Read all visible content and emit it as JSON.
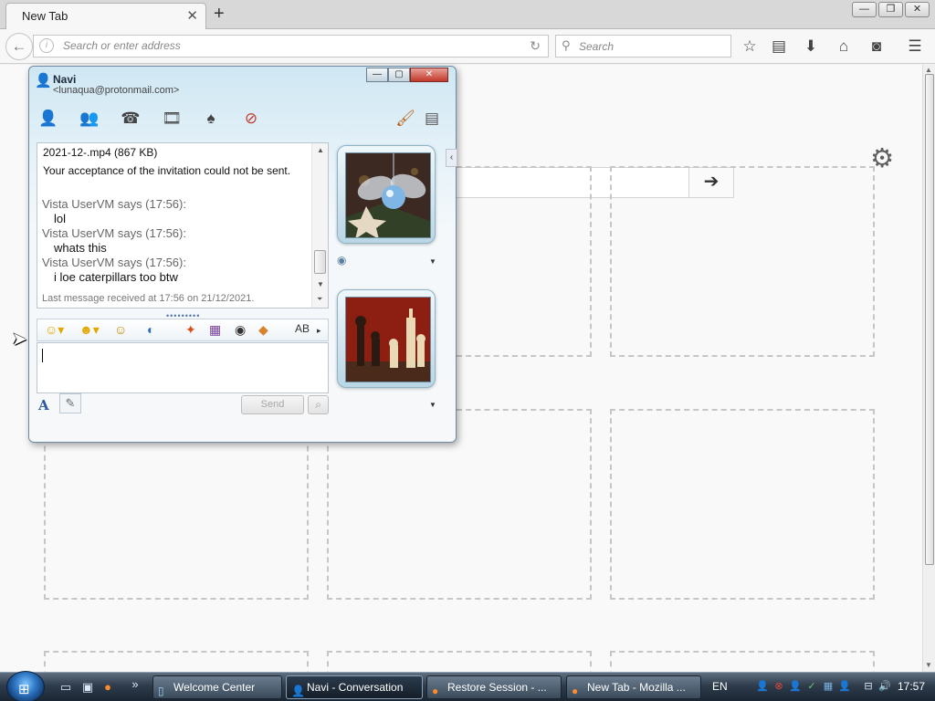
{
  "browser": {
    "tab_title": "New Tab",
    "tab_close": "✕",
    "new_tab": "+",
    "url_placeholder": "Search or enter address",
    "search_placeholder": "Search",
    "window_buttons": {
      "minimize": "—",
      "restore": "❐",
      "close": "✕"
    }
  },
  "newtab_page": {
    "go_arrow": "➔"
  },
  "messenger": {
    "contact_name": "Navi",
    "contact_email": "<lunaqua@protonmail.com>",
    "window_buttons": {
      "minimize": "—",
      "restore": "▢",
      "close": "✕"
    },
    "history": {
      "file_line": "2021-12-.mp4 (867 KB)",
      "notice": "Your acceptance of the invitation could not be sent.",
      "messages": [
        {
          "header": "Vista UserVM says (17:56):",
          "text": "lol"
        },
        {
          "header": "Vista UserVM says (17:56):",
          "text": "whats this"
        },
        {
          "header": "Vista UserVM says (17:56):",
          "text": "i loe caterpillars too btw"
        }
      ],
      "last_message": "Last message received at 17:56 on 21/12/2021."
    },
    "input_value": "",
    "send_label": "Send",
    "font_label": "A",
    "collapse_arrow": "‹"
  },
  "taskbar": {
    "overflow": "»",
    "buttons": [
      {
        "label": "Welcome Center",
        "icon": "welcome-center-icon"
      },
      {
        "label": "Navi - Conversation",
        "icon": "messenger-icon"
      },
      {
        "label": "Restore Session - ...",
        "icon": "firefox-icon"
      },
      {
        "label": "New Tab - Mozilla ...",
        "icon": "firefox-icon"
      }
    ],
    "language": "EN",
    "clock": "17:57"
  },
  "colors": {
    "taskbar": "#2e3c4c",
    "messenger_header": "#cfe7f3",
    "close_red": "#c1392b"
  }
}
